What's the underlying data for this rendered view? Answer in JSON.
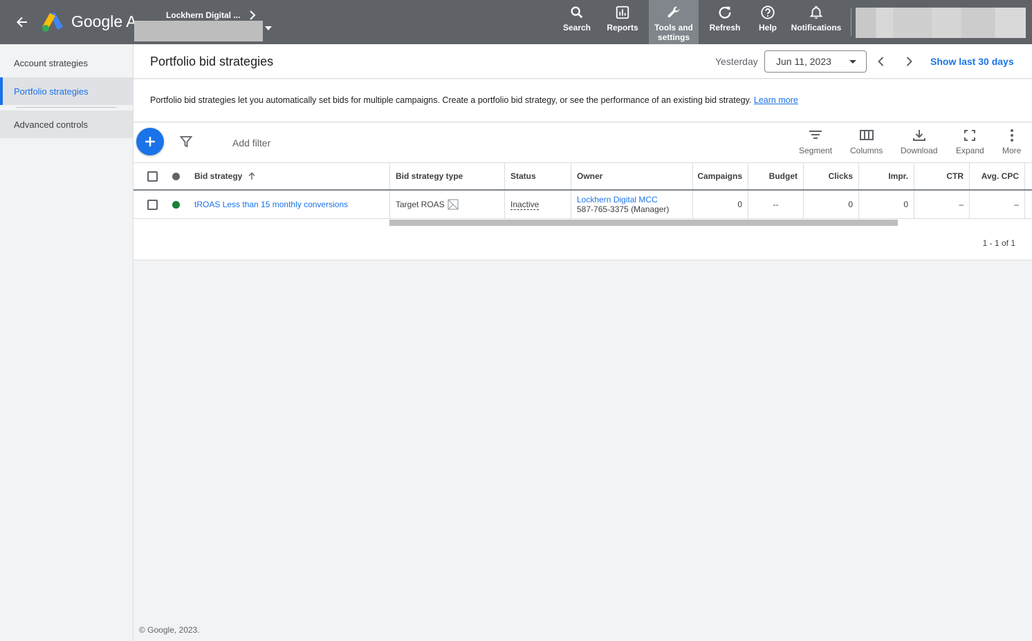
{
  "topbar": {
    "brand": "Google Ads",
    "account_name": "Lockhern Digital ...",
    "nav": [
      {
        "label": "Search",
        "icon": "search-icon"
      },
      {
        "label": "Reports",
        "icon": "reports-icon"
      },
      {
        "label": "Tools and settings",
        "icon": "wrench-icon"
      },
      {
        "label": "Refresh",
        "icon": "refresh-icon"
      },
      {
        "label": "Help",
        "icon": "help-icon"
      },
      {
        "label": "Notifications",
        "icon": "bell-icon"
      }
    ]
  },
  "sidebar": {
    "items": [
      {
        "label": "Account strategies"
      },
      {
        "label": "Portfolio strategies"
      },
      {
        "label": "Advanced controls"
      }
    ]
  },
  "header": {
    "title": "Portfolio bid strategies",
    "date_label": "Yesterday",
    "date_value": "Jun 11, 2023",
    "show_last": "Show last 30 days"
  },
  "description": {
    "text": "Portfolio bid strategies let you automatically set bids for multiple campaigns. Create a portfolio bid strategy, or see the performance of an existing bid strategy.",
    "link": "Learn more"
  },
  "toolbar": {
    "add_filter": "Add filter",
    "tools": [
      {
        "label": "Segment",
        "icon": "segment-icon"
      },
      {
        "label": "Columns",
        "icon": "columns-icon"
      },
      {
        "label": "Download",
        "icon": "download-icon"
      },
      {
        "label": "Expand",
        "icon": "expand-icon"
      },
      {
        "label": "More",
        "icon": "more-vert-icon"
      }
    ]
  },
  "table": {
    "headers": {
      "bid_strategy": "Bid strategy",
      "type": "Bid strategy type",
      "status": "Status",
      "owner": "Owner",
      "campaigns": "Campaigns",
      "budget": "Budget",
      "clicks": "Clicks",
      "impr": "Impr.",
      "ctr": "CTR",
      "avg_cpc": "Avg. CPC"
    },
    "rows": [
      {
        "name": "tROAS Less than 15 monthly conversions",
        "type": "Target ROAS",
        "status": "Inactive",
        "owner_name": "Lockhern Digital MCC",
        "owner_id": "587-765-3375 (Manager)",
        "campaigns": "0",
        "budget": "--",
        "clicks": "0",
        "impr": "0",
        "ctr": "–",
        "avg_cpc": "–"
      }
    ],
    "pagination": "1 - 1 of 1"
  },
  "footer": "© Google, 2023.",
  "colors": {
    "topbar": "#5f6368",
    "accent": "#1a73e8",
    "status_enabled": "#188038"
  }
}
